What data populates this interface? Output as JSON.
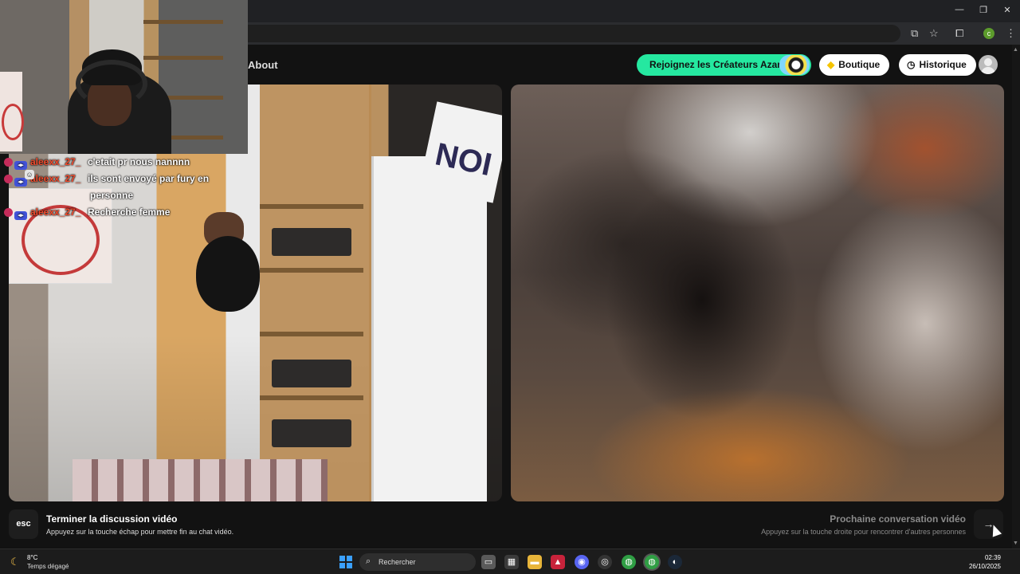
{
  "app": {
    "nav_about": "About",
    "creators_button": "Rejoignez les Créateurs Azar",
    "shop_button": "Boutique",
    "history_button": "Historique"
  },
  "bottom": {
    "esc_key": "esc",
    "end_title": "Terminer la discussion vidéo",
    "end_subtitle": "Appuyez sur la touche échap pour mettre fin au chat vidéo.",
    "next_title": "Prochaine conversation vidéo",
    "next_subtitle": "Appuyez sur la touche droite pour rencontrer d'autres personnes",
    "next_icon": "→"
  },
  "chat": {
    "messages": [
      {
        "user": "aleexx_27_",
        "text": "c'etait pr nous nannnn"
      },
      {
        "user": "aleexx_27_",
        "text": "ils sont envoyé par fury en",
        "cont": "personne"
      },
      {
        "user": "aleexx_27_",
        "text": "Recherche femme"
      }
    ]
  },
  "taskbar": {
    "temperature": "8°C",
    "weather": "Temps dégagé",
    "search_placeholder": "Rechercher",
    "time": "02:39",
    "date": "26/10/2025"
  },
  "colors": {
    "accent_green": "#25e8a0",
    "chat_username": "#f04a2c"
  }
}
